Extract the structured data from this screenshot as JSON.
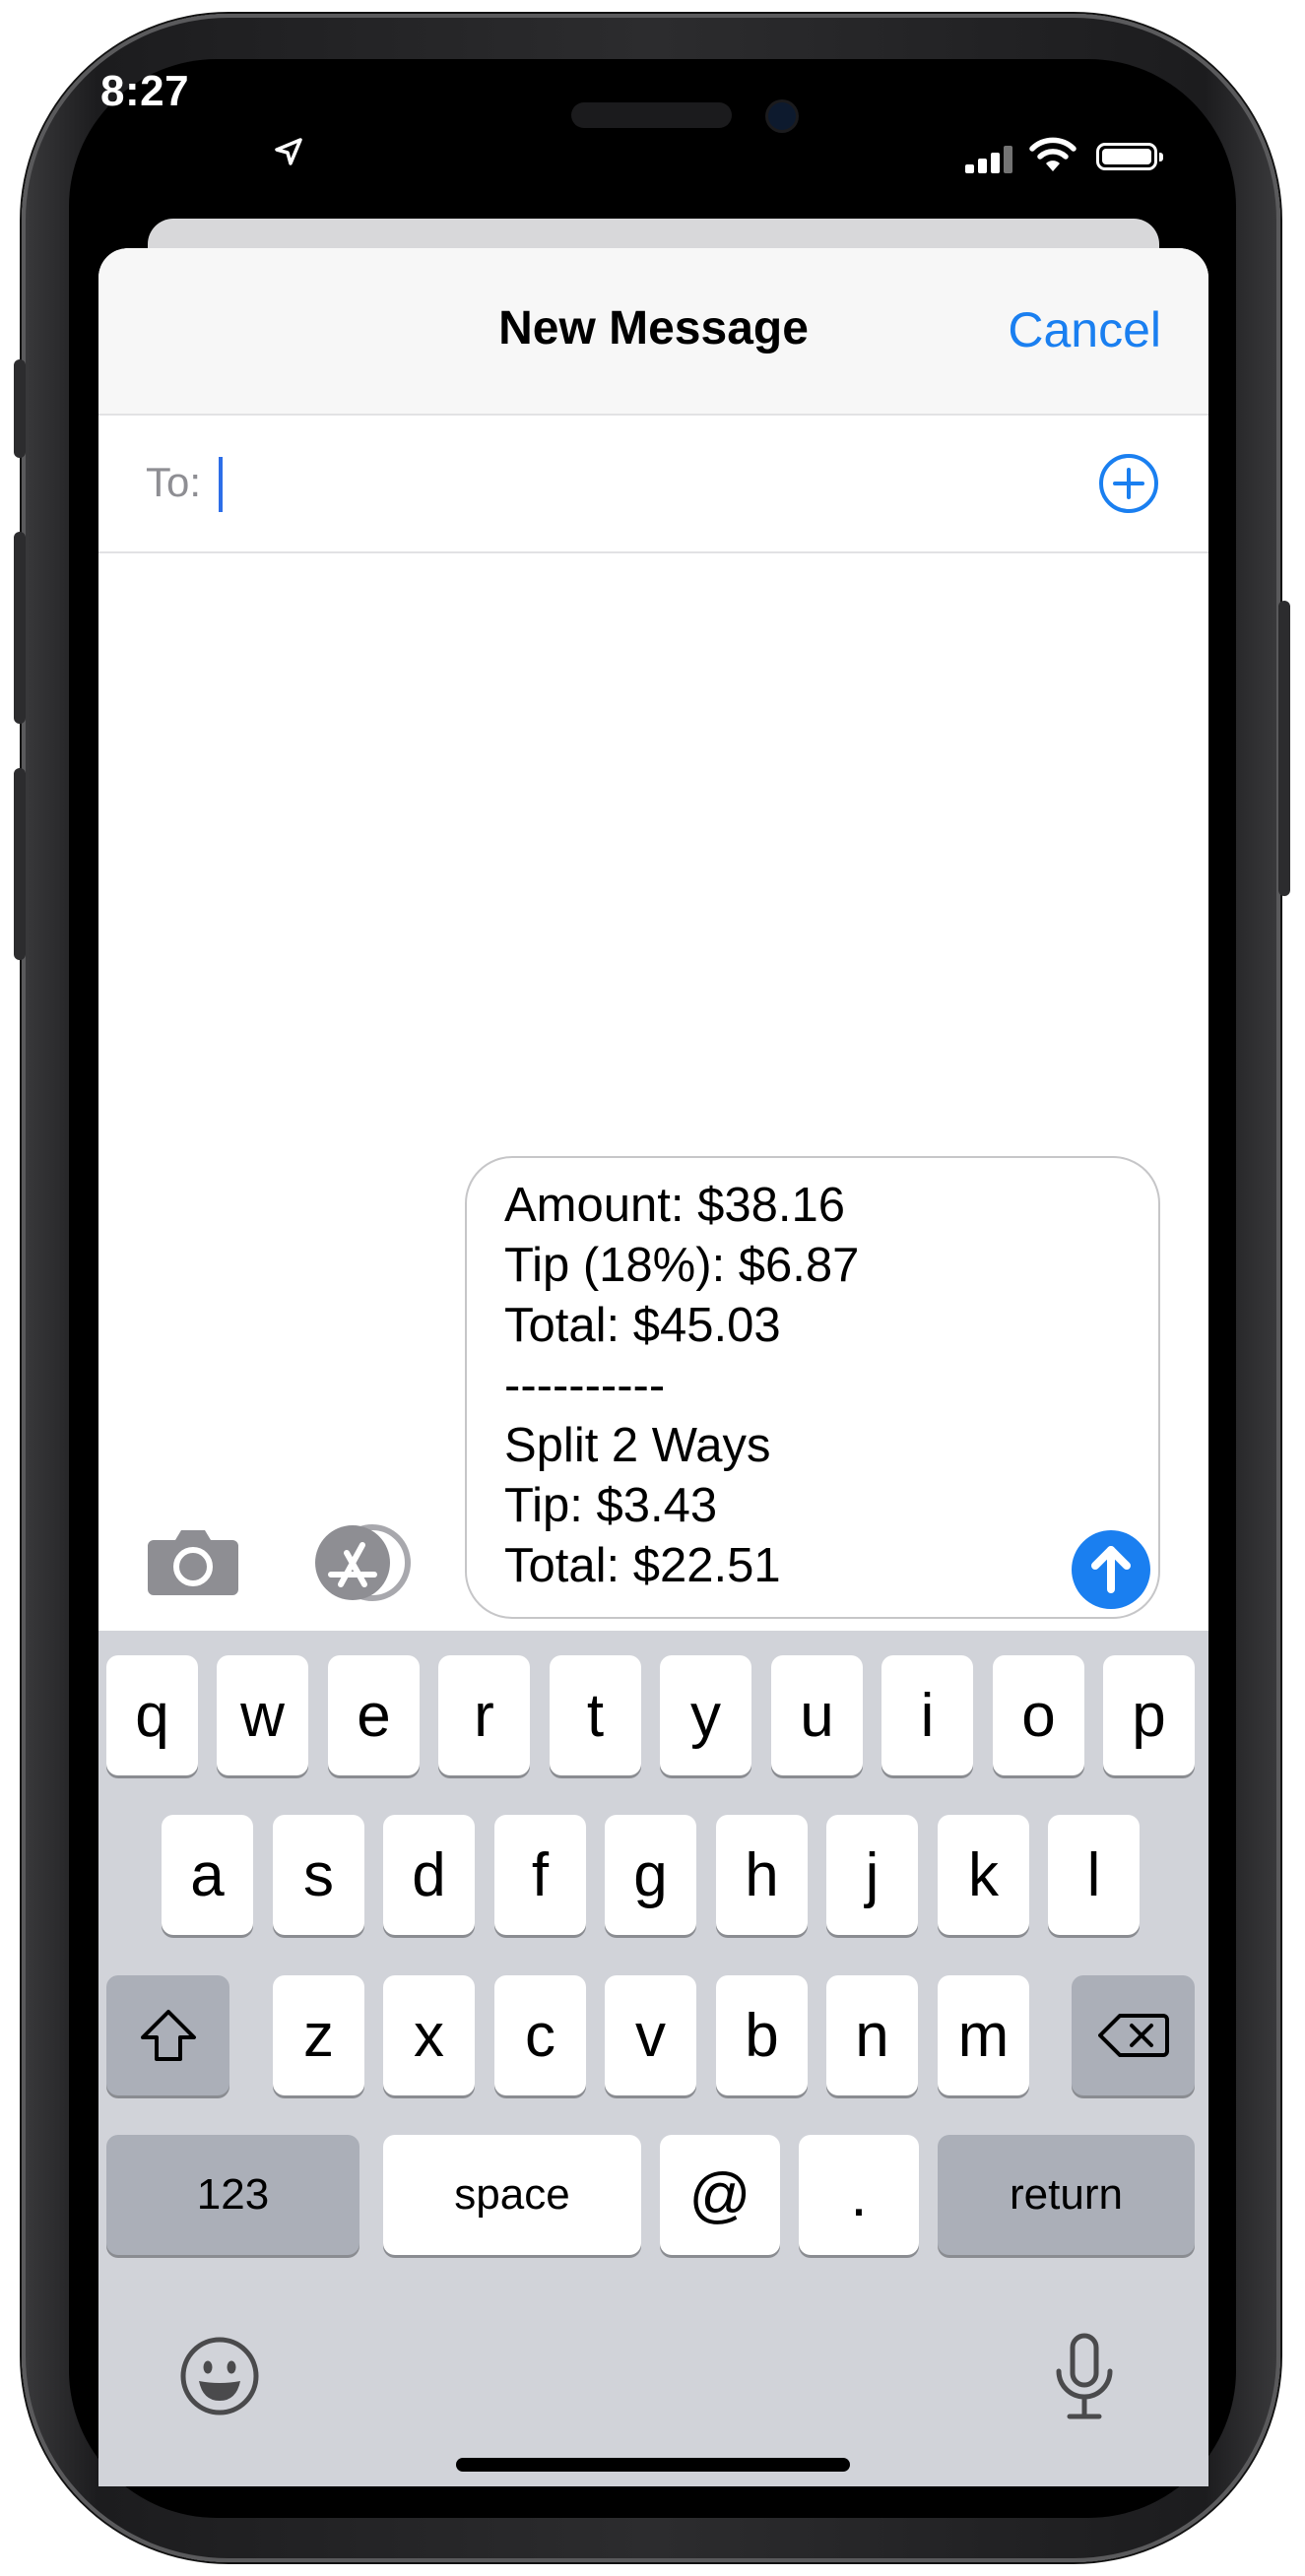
{
  "status_bar": {
    "time": "8:27",
    "icons": [
      "location-arrow-icon",
      "cellular-signal-icon",
      "wifi-icon",
      "battery-icon"
    ]
  },
  "nav": {
    "title": "New Message",
    "cancel_label": "Cancel"
  },
  "to_field": {
    "label": "To:",
    "value": "",
    "add_icon": "plus-circle-icon"
  },
  "compose": {
    "lines": [
      "Amount: $38.16",
      "Tip (18%): $6.87",
      "Total: $45.03",
      "----------",
      "Split 2 Ways",
      "Tip: $3.43",
      "Total: $22.51"
    ],
    "send_icon": "arrow-up-icon",
    "camera_icon": "camera-icon",
    "apps_icon": "app-store-icon"
  },
  "keyboard": {
    "row1": [
      "q",
      "w",
      "e",
      "r",
      "t",
      "y",
      "u",
      "i",
      "o",
      "p"
    ],
    "row2": [
      "a",
      "s",
      "d",
      "f",
      "g",
      "h",
      "j",
      "k",
      "l"
    ],
    "row3": [
      "z",
      "x",
      "c",
      "v",
      "b",
      "n",
      "m"
    ],
    "numbers_label": "123",
    "space_label": "space",
    "at_label": "@",
    "period_label": ".",
    "return_label": "return",
    "shift_icon": "shift-icon",
    "delete_icon": "delete-icon",
    "emoji_icon": "emoji-icon",
    "mic_icon": "microphone-icon"
  },
  "colors": {
    "accent": "#1a7ff0",
    "keyboard_bg": "#d1d3d9",
    "key_gray": "#abafb8"
  }
}
